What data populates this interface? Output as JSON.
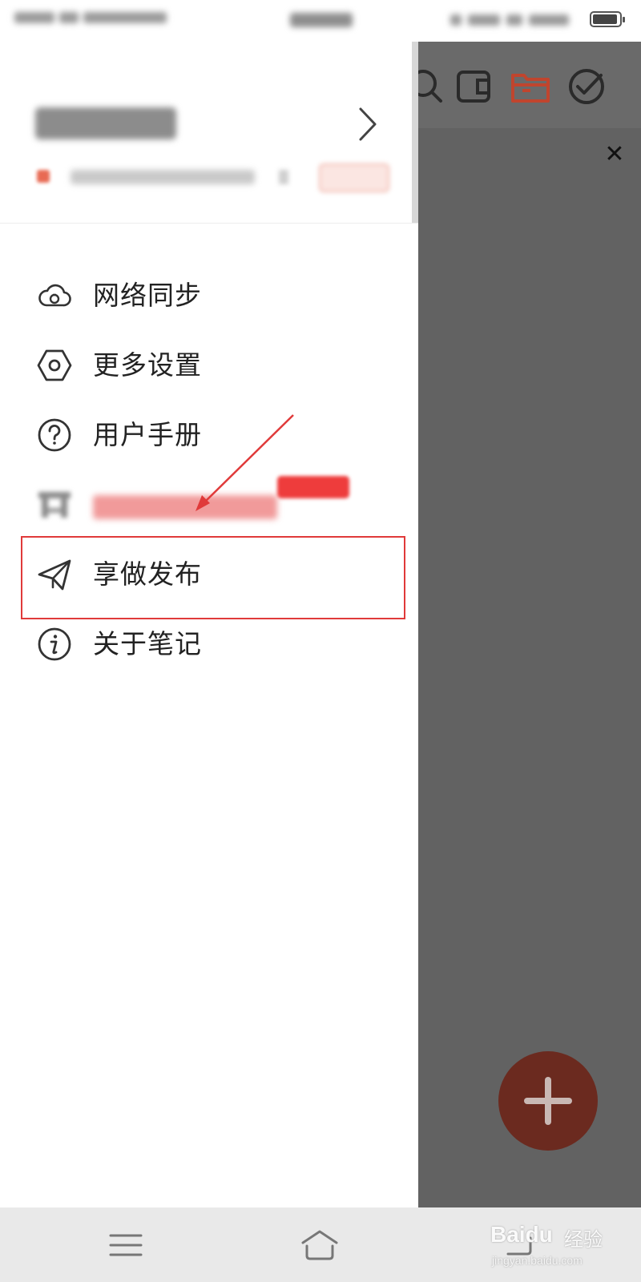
{
  "menu": {
    "items": [
      {
        "label": "网络同步",
        "icon": "cloud-sync-icon"
      },
      {
        "label": "更多设置",
        "icon": "settings-hexagon-icon"
      },
      {
        "label": "用户手册",
        "icon": "help-circle-icon"
      },
      {
        "label": "享做发布",
        "icon": "paper-plane-icon"
      },
      {
        "label": "关于笔记",
        "icon": "info-circle-icon"
      }
    ]
  },
  "toolbar": {
    "icons": [
      "search-icon",
      "wallet-icon",
      "folder-icon",
      "check-circle-icon"
    ],
    "active_color": "#c0452e"
  },
  "watermark": {
    "brand": "Baidu",
    "cn": "经验",
    "url": "jingyan.baidu.com"
  },
  "colors": {
    "highlight": "#e03a3a",
    "overlay": "#626262",
    "fab": "#6b2a1f"
  }
}
